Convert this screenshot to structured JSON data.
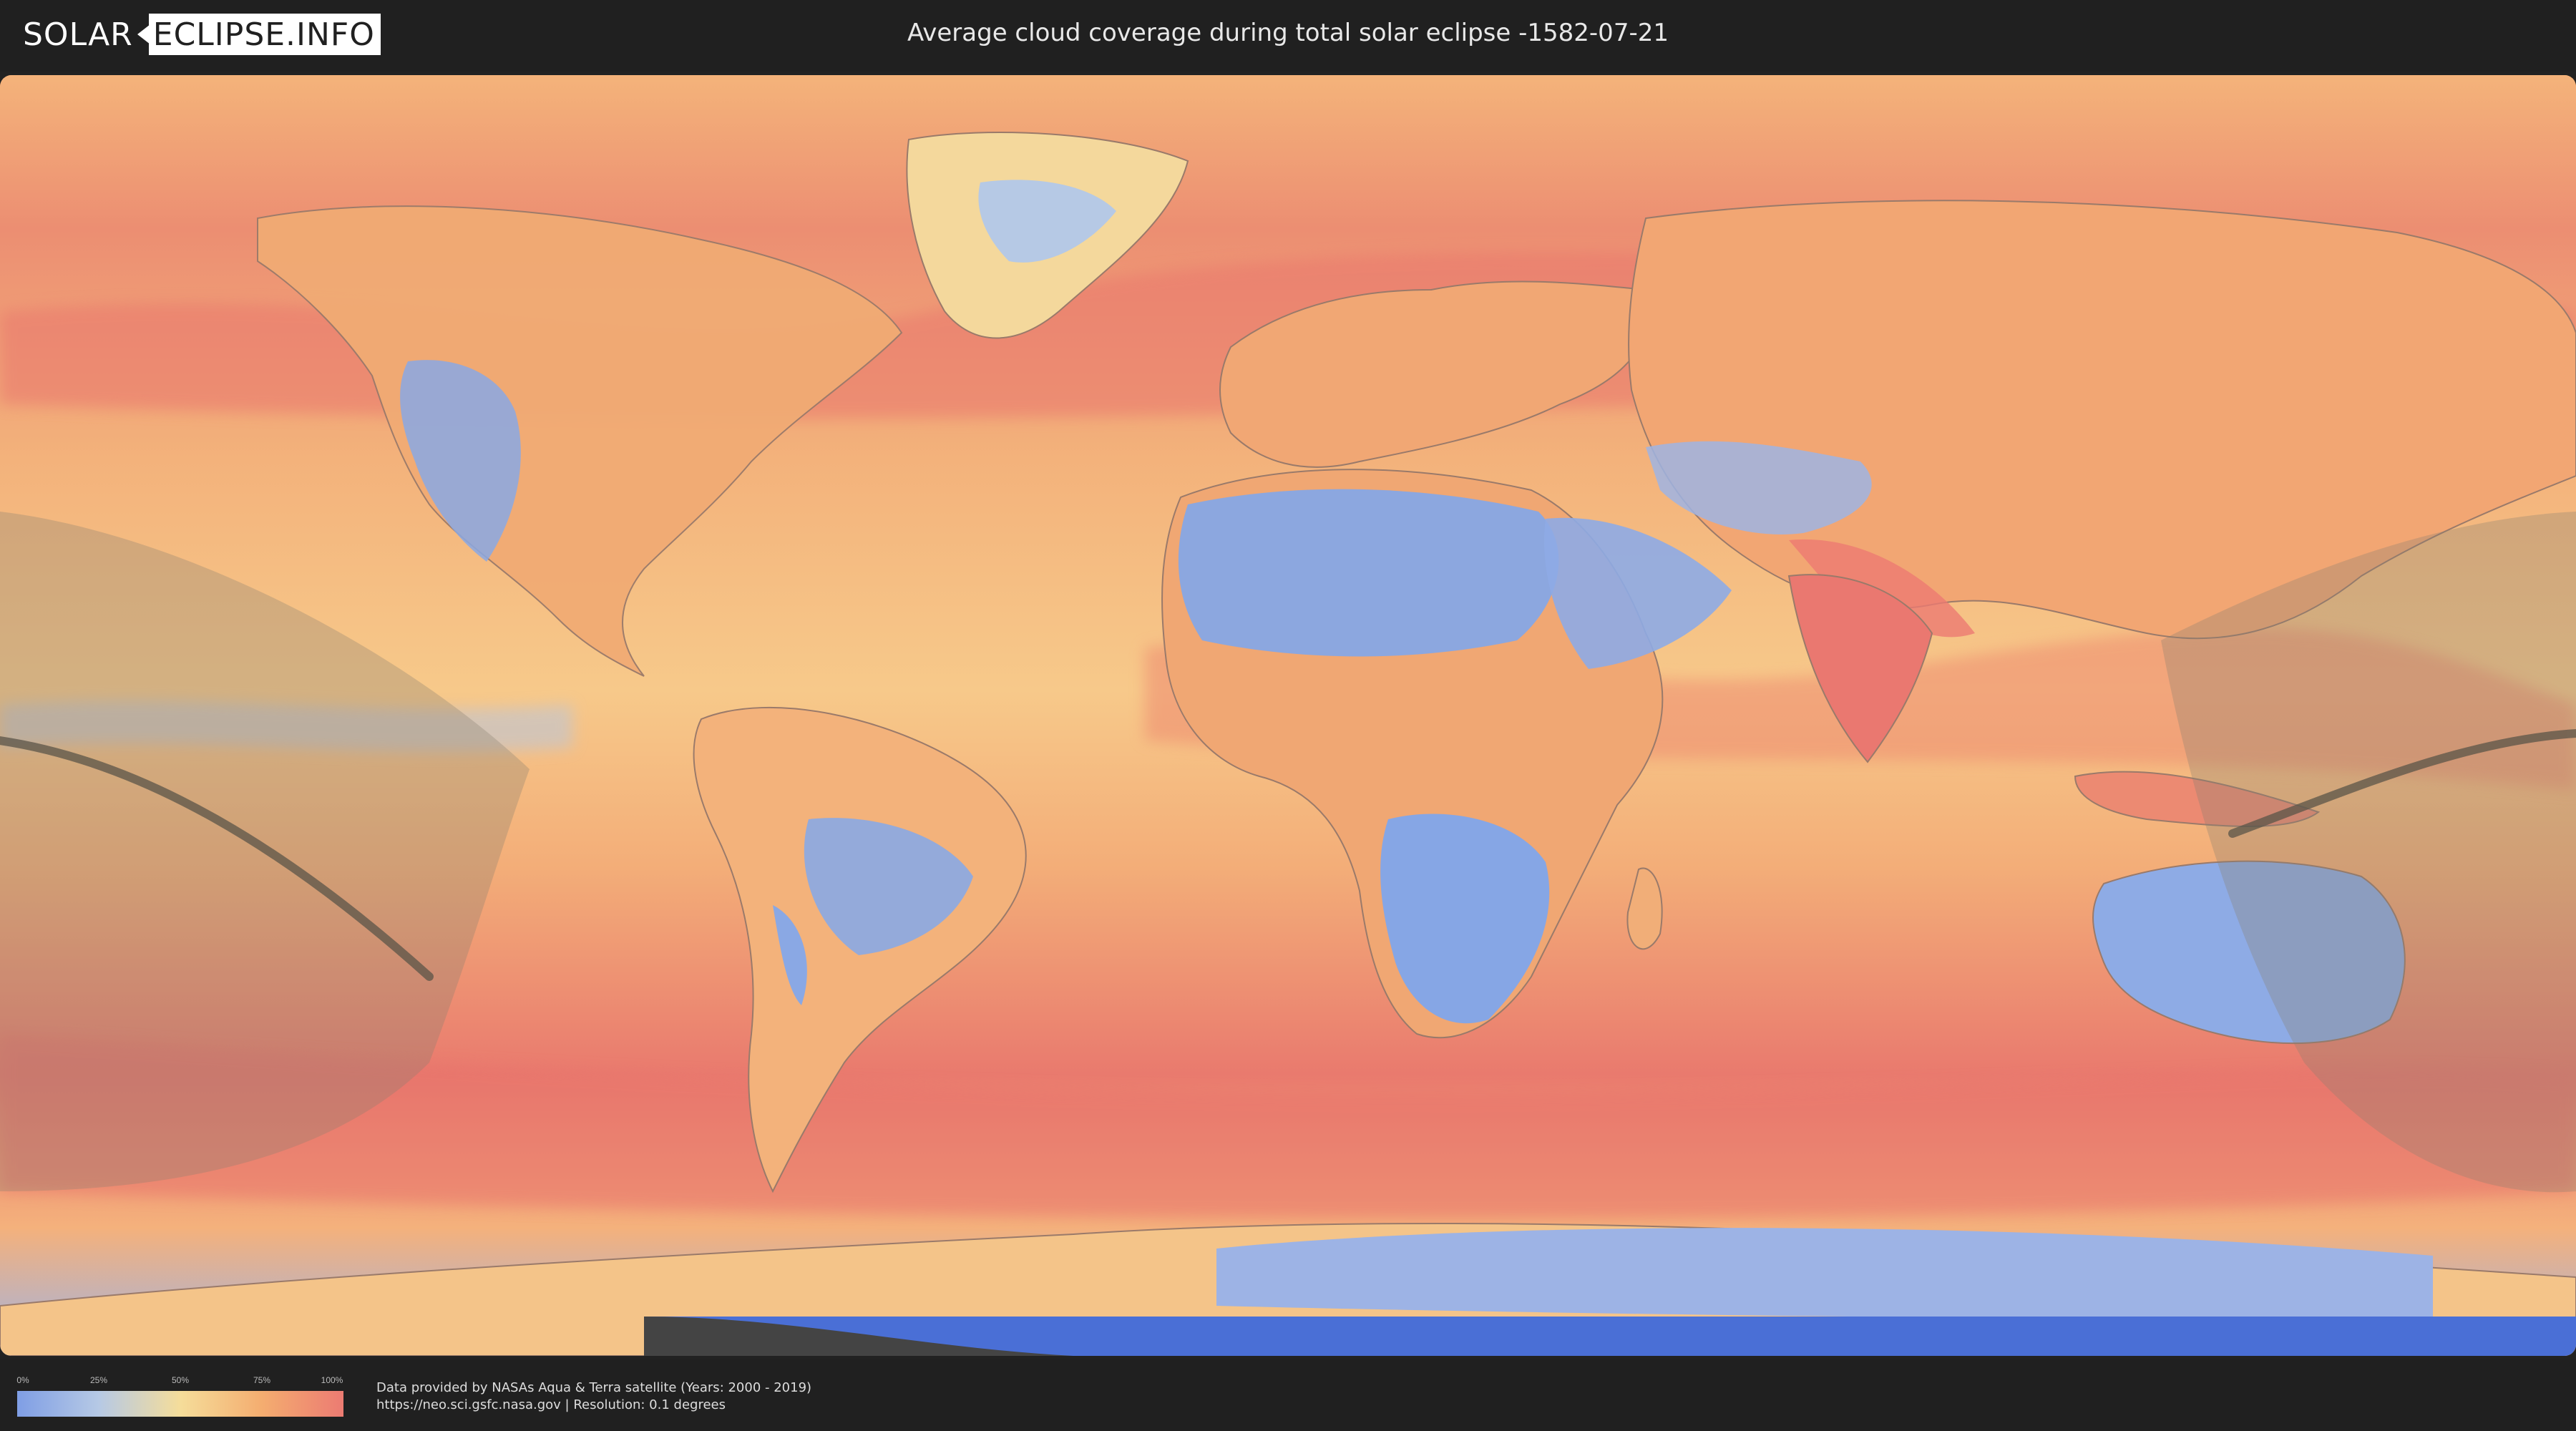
{
  "logo": {
    "solar": "SOLAR",
    "eclipse": "ECLIPSE.INFO"
  },
  "title": "Average cloud coverage during total solar eclipse -1582-07-21",
  "legend": {
    "ticks": [
      "0%",
      "25%",
      "50%",
      "75%",
      "100%"
    ],
    "colors": [
      "#7f9ee5",
      "#b6c9e5",
      "#f5dd9a",
      "#f4ad70",
      "#ec7b72"
    ]
  },
  "credits": {
    "line1": "Data provided by NASAs Aqua & Terra satellite (Years: 2000 - 2019)",
    "line2": "https://neo.sci.gsfc.nasa.gov | Resolution: 0.1 degrees"
  }
}
